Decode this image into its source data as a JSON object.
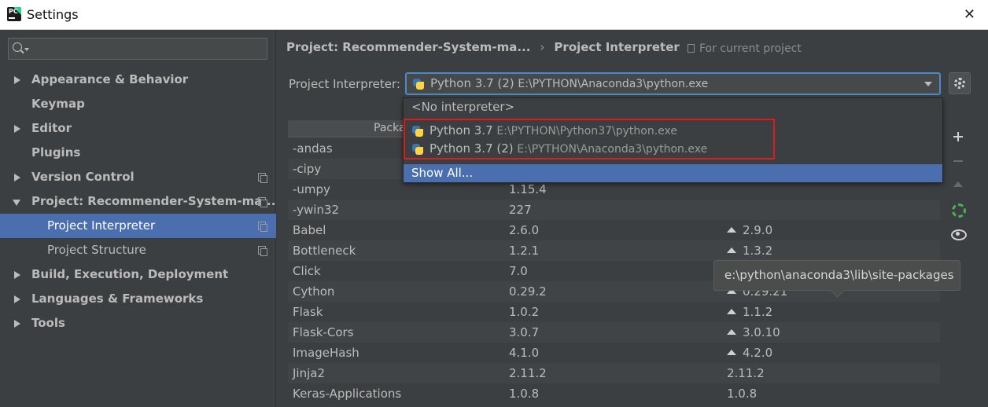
{
  "window": {
    "title": "Settings",
    "close_glyph": "✕",
    "app_icon": "pycharm-icon"
  },
  "search": {
    "placeholder": ""
  },
  "sidebar": {
    "items": [
      {
        "label": "Appearance & Behavior"
      },
      {
        "label": "Keymap"
      },
      {
        "label": "Editor"
      },
      {
        "label": "Plugins"
      },
      {
        "label": "Version Control"
      },
      {
        "label": "Project: Recommender-System-ma..."
      },
      {
        "label": "Project Interpreter"
      },
      {
        "label": "Project Structure"
      },
      {
        "label": "Build, Execution, Deployment"
      },
      {
        "label": "Languages & Frameworks"
      },
      {
        "label": "Tools"
      }
    ]
  },
  "breadcrumb": {
    "project": "Project: Recommender-System-ma...",
    "separator": "›",
    "page": "Project Interpreter",
    "scope": "For current project"
  },
  "interpreter": {
    "label": "Project Interpreter:",
    "selected_name": "Python 3.7 (2)",
    "selected_path": "E:\\PYTHON\\Anaconda3\\python.exe",
    "options": [
      {
        "label": "<No interpreter>"
      },
      {
        "name": "Python 3.7",
        "path": "E:\\PYTHON\\Python37\\python.exe"
      },
      {
        "name": "Python 3.7 (2)",
        "path": "E:\\PYTHON\\Anaconda3\\python.exe"
      },
      {
        "label": "Show All..."
      }
    ]
  },
  "table": {
    "header_package": "Packa",
    "rows": [
      {
        "package": "-andas",
        "version": "",
        "latest": "",
        "upgrade": false
      },
      {
        "package": "-cipy",
        "version": "",
        "latest": "",
        "upgrade": false
      },
      {
        "package": "-umpy",
        "version": "1.15.4",
        "latest": "",
        "upgrade": false
      },
      {
        "package": "-ywin32",
        "version": "227",
        "latest": "",
        "upgrade": false
      },
      {
        "package": "Babel",
        "version": "2.6.0",
        "latest": "2.9.0",
        "upgrade": true
      },
      {
        "package": "Bottleneck",
        "version": "1.2.1",
        "latest": "1.3.2",
        "upgrade": true
      },
      {
        "package": "Click",
        "version": "7.0",
        "latest": "",
        "upgrade": false
      },
      {
        "package": "Cython",
        "version": "0.29.2",
        "latest": "0.29.21",
        "upgrade": true
      },
      {
        "package": "Flask",
        "version": "1.0.2",
        "latest": "1.1.2",
        "upgrade": true
      },
      {
        "package": "Flask-Cors",
        "version": "3.0.7",
        "latest": "3.0.10",
        "upgrade": true
      },
      {
        "package": "ImageHash",
        "version": "4.1.0",
        "latest": "4.2.0",
        "upgrade": true
      },
      {
        "package": "Jinja2",
        "version": "2.11.2",
        "latest": "2.11.2",
        "upgrade": false
      },
      {
        "package": "Keras-Applications",
        "version": "1.0.8",
        "latest": "1.0.8",
        "upgrade": false
      }
    ]
  },
  "tooltip": {
    "text": "e:\\python\\anaconda3\\lib\\site-packages"
  },
  "colors": {
    "background": "#3c3f41",
    "selection": "#4b6eaf",
    "focus_border": "#4a88c7",
    "highlight_box": "#e01b1b"
  }
}
